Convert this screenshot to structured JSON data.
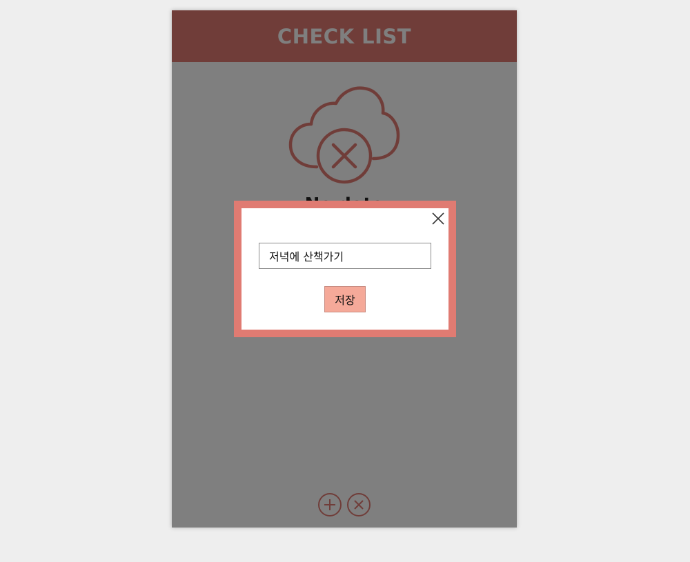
{
  "app": {
    "title": "CHECK LIST",
    "empty_text": "No data"
  },
  "modal": {
    "input_value": "저녁에 산책가기",
    "save_label": "저장"
  },
  "icons": {
    "empty_state": "cloud-x-icon",
    "add": "plus-icon",
    "delete": "x-icon",
    "close": "close-icon"
  },
  "colors": {
    "accent": "#e07b72",
    "button": "#f5a999",
    "page_bg": "#eeeeee"
  }
}
